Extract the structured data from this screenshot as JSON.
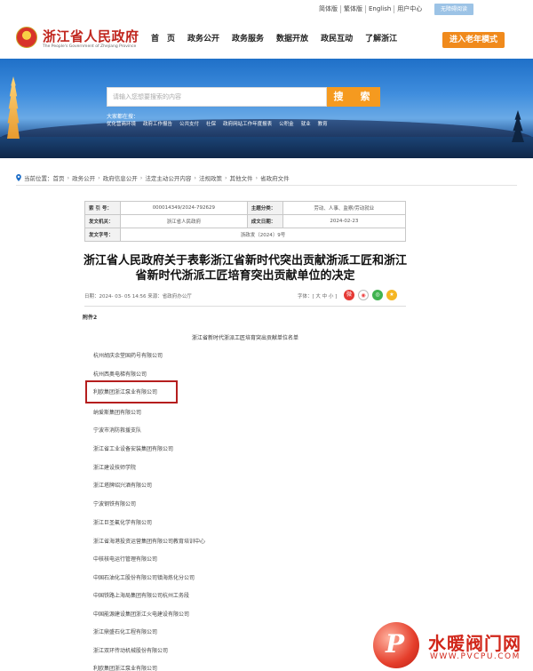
{
  "topbar": {
    "links": [
      "简体版",
      "繁体版",
      "English",
      "用户中心"
    ],
    "access_label": "无障碍阅读"
  },
  "header": {
    "site_name": "浙江省人民政府",
    "site_sub": "The People's Government of Zhejiang Province",
    "nav": [
      "首　页",
      "政务公开",
      "政务服务",
      "数据开放",
      "政民互动",
      "了解浙江"
    ],
    "elder_mode": "进入老年模式"
  },
  "search": {
    "placeholder": "请输入您想要搜索的内容",
    "button": "搜　索",
    "hot_label": "大家都在搜：",
    "hot_links": [
      "优化营商环境",
      "政府工作报告",
      "公共支付",
      "社保",
      "政府网站工作年度报表",
      "公积金",
      "就业",
      "教育"
    ]
  },
  "breadcrumb": {
    "prefix": "当前位置：",
    "items": [
      "首页",
      "政务公开",
      "政府信息公开",
      "法定主动公开内容",
      "法规政策",
      "其他文件",
      "省政府文件"
    ]
  },
  "meta": {
    "index_label": "索 引 号：",
    "index_value": "000014349/2024-792629",
    "topic_label": "主题分类：",
    "topic_value": "劳动、人事、监察/劳动就业",
    "issuer_label": "发文机关：",
    "issuer_value": "浙江省人民政府",
    "date_label": "成文日期：",
    "date_value": "2024-02-23",
    "doc_label": "发文字号：",
    "doc_value": "浙政发〔2024〕9号"
  },
  "article": {
    "title": "浙江省人民政府关于表彰浙江省新时代突出贡献浙派工匠和浙江省新时代浙派工匠培育突出贡献单位的决定",
    "date": "日期：2024- 03- 05 14:56  来源：省政府办公厅",
    "font_size": "字体：[ 大  中  小 ]"
  },
  "attachment": {
    "label": "附件2",
    "list_title": "浙江省新时代浙派工匠培育突出贡献单位名单",
    "items": [
      "杭州胡庆余堂国药号有限公司",
      "杭州西奥电梯有限公司",
      "利欧集团浙江泵业有限公司",
      "纳爱斯集团有限公司",
      "宁波市消防救援支队",
      "浙江省工业设备安装集团有限公司",
      "浙江建设技师学院",
      "浙江塔牌绍兴酒有限公司",
      "宁波钢铁有限公司",
      "浙江巨圣氟化学有限公司",
      "浙江省海港投资运营集团有限公司教育培训中心",
      "中核核电运行管理有限公司",
      "中国石油化工股份有限公司镇海炼化分公司",
      "中国铁路上海局集团有限公司杭州工务段",
      "中国能源建设集团浙江火电建设有限公司",
      "浙江鼎盛石化工程有限公司",
      "浙江双环传动机械股份有限公司",
      "利欧集团浙江泵业有限公司"
    ]
  },
  "watermark": {
    "brand": "水暖阀门网",
    "url": "WWW.PVCPU.COM"
  },
  "colors": {
    "brand_red": "#c0251d",
    "accent_orange": "#f59a1f",
    "highlight_red": "#b51e1e"
  }
}
